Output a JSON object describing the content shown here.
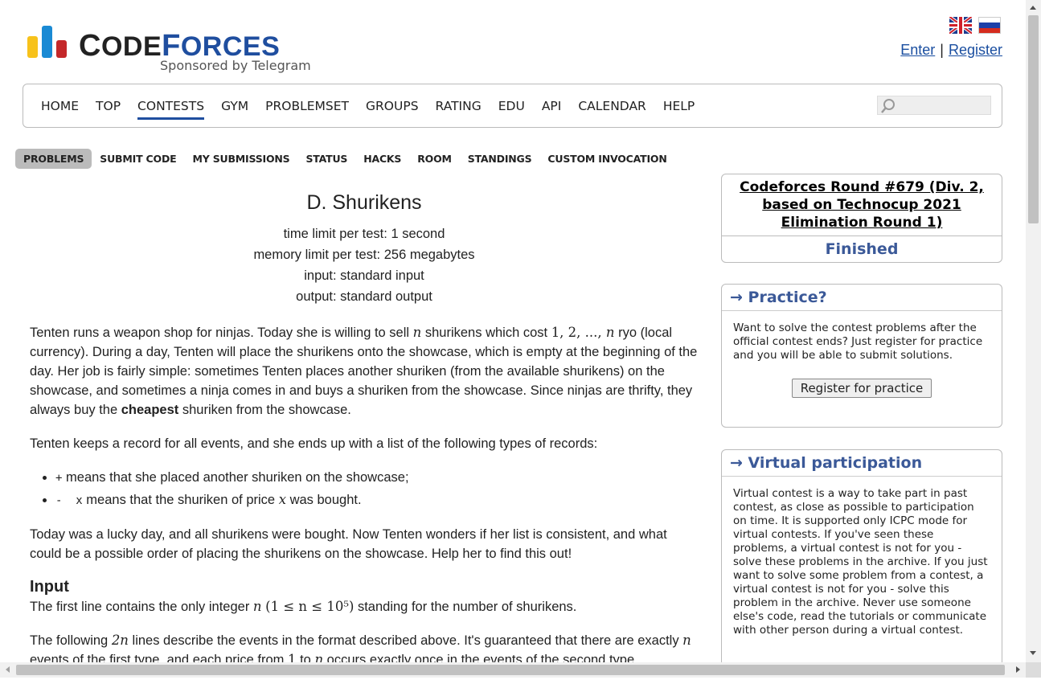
{
  "header": {
    "logo_part1": "C",
    "logo_part2": "ODE",
    "logo_part3": "F",
    "logo_part4": "ORCES",
    "sponsor": "Sponsored by Telegram",
    "enter": "Enter",
    "separator": "|",
    "register": "Register"
  },
  "menu": {
    "items": [
      "HOME",
      "TOP",
      "CONTESTS",
      "GYM",
      "PROBLEMSET",
      "GROUPS",
      "RATING",
      "EDU",
      "API",
      "CALENDAR",
      "HELP"
    ],
    "active": "CONTESTS"
  },
  "submenu": {
    "items": [
      "PROBLEMS",
      "SUBMIT CODE",
      "MY SUBMISSIONS",
      "STATUS",
      "HACKS",
      "ROOM",
      "STANDINGS",
      "CUSTOM INVOCATION"
    ],
    "active": "PROBLEMS"
  },
  "problem": {
    "title": "D. Shurikens",
    "time_limit": "time limit per test: 1 second",
    "memory_limit": "memory limit per test: 256 megabytes",
    "input": "input: standard input",
    "output": "output: standard output",
    "p1_a": "Tenten runs a weapon shop for ninjas. Today she is willing to sell ",
    "p1_b": " shurikens which cost ",
    "p1_c": " ryo (local currency). During a day, Tenten will place the shurikens onto the showcase, which is empty at the beginning of the day. Her job is fairly simple: sometimes Tenten places another shuriken (from the available shurikens) on the showcase, and sometimes a ninja comes in and buys a shuriken from the showcase. Since ninjas are thrifty, they always buy the ",
    "p1_bold": "cheapest",
    "p1_d": " shuriken from the showcase.",
    "p2": "Tenten keeps a record for all events, and she ends up with a list of the following types of records:",
    "li1_code": "+",
    "li1_text": " means that she placed another shuriken on the showcase;",
    "li2_code": "-  x",
    "li2_text": " means that the shuriken of price ",
    "li2_end": " was bought.",
    "p3": "Today was a lucky day, and all shurikens were bought. Now Tenten wonders if her list is consistent, and what could be a possible order of placing the shurikens on the showcase. Help her to find this out!",
    "input_title": "Input",
    "input_a": "The first line contains the only integer ",
    "input_b": " standing for the number of shurikens.",
    "p4_a": "The following ",
    "p4_b": " lines describe the events in the format described above. It's guaranteed that there are exactly ",
    "p4_c": " events of the first type, and each price from ",
    "p4_d": " to ",
    "p4_e": " occurs exactly once in the events of the second type.",
    "var_n": "n",
    "var_x": "x",
    "costs": "1, 2, ..., ",
    "constraint": "(1 ≤ n ≤ 10⁵)",
    "two_n": "2n",
    "one": "1"
  },
  "sidebar": {
    "contest_title": "Codeforces Round #679 (Div. 2, based on Technocup 2021 Elimination Round 1)",
    "contest_status": "Finished",
    "practice_head": "→ Practice?",
    "practice_text": "Want to solve the contest problems after the official contest ends? Just register for practice and you will be able to submit solutions.",
    "practice_button": "Register for practice",
    "virtual_head": "→ Virtual participation",
    "virtual_text": "Virtual contest is a way to take part in past contest, as close as possible to participation on time. It is supported only ICPC mode for virtual contests. If you've seen these problems, a virtual contest is not for you - solve these problems in the archive. If you just want to solve some problem from a contest, a virtual contest is not for you - solve this problem in the archive. Never use someone else's code, read the tutorials or communicate with other person during a virtual contest."
  },
  "colors": {
    "logo_yellow": "#f7c21b",
    "logo_blue": "#1a8ad4",
    "logo_red": "#c4282a",
    "brand_blue": "#1f4e9f",
    "link_blue": "#1a4ea0",
    "box_head_blue": "#3b5998"
  }
}
